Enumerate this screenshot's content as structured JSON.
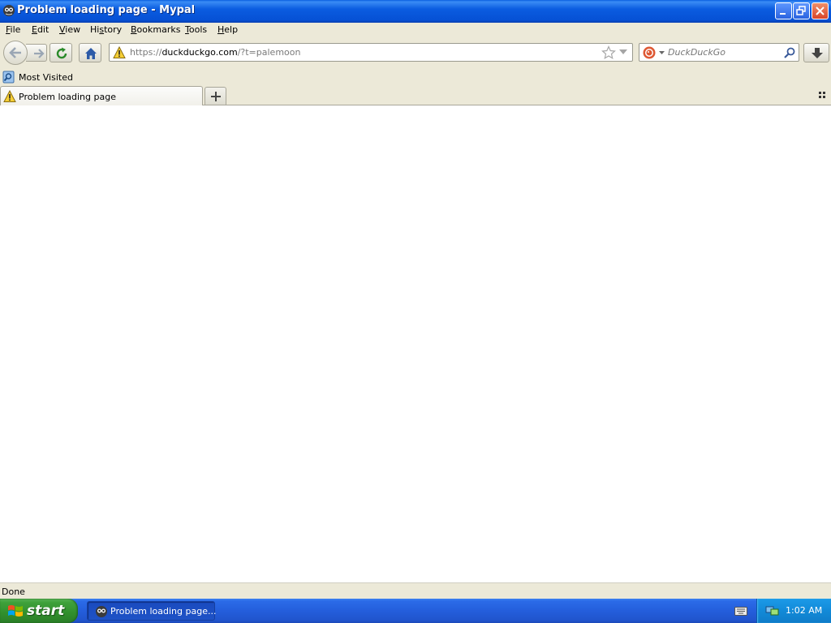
{
  "window": {
    "title": "Problem loading page - Mypal",
    "controls": {
      "minimize": "minimize-icon",
      "restore": "restore-icon",
      "close": "close-icon"
    }
  },
  "menubar": {
    "items": [
      {
        "pre": "",
        "acc": "F",
        "post": "ile"
      },
      {
        "pre": "",
        "acc": "E",
        "post": "dit"
      },
      {
        "pre": "",
        "acc": "V",
        "post": "iew"
      },
      {
        "pre": "Hi",
        "acc": "s",
        "post": "tory"
      },
      {
        "pre": "",
        "acc": "B",
        "post": "ookmarks"
      },
      {
        "pre": "",
        "acc": "T",
        "post": "ools"
      },
      {
        "pre": "",
        "acc": "H",
        "post": "elp"
      }
    ]
  },
  "navbar": {
    "url_prefix": "https://",
    "url_host": "duckduckgo.com",
    "url_path": "/?t=palemoon",
    "search_engine": "DuckDuckGo",
    "search_placeholder": "DuckDuckGo"
  },
  "bookmarks": {
    "items": [
      {
        "label": "Most Visited"
      }
    ]
  },
  "tabs": [
    {
      "label": "Problem loading page",
      "active": true
    }
  ],
  "statusbar": {
    "text": "Done"
  },
  "taskbar": {
    "start_label": "start",
    "tasks": [
      {
        "label": "Problem loading page..."
      }
    ],
    "clock": "1:02 AM"
  },
  "colors": {
    "titlebar": "#0a5fe0",
    "chrome": "#ece9d8",
    "taskbar": "#245edc",
    "start_button": "#3fa13b",
    "tray": "#128ad8"
  }
}
